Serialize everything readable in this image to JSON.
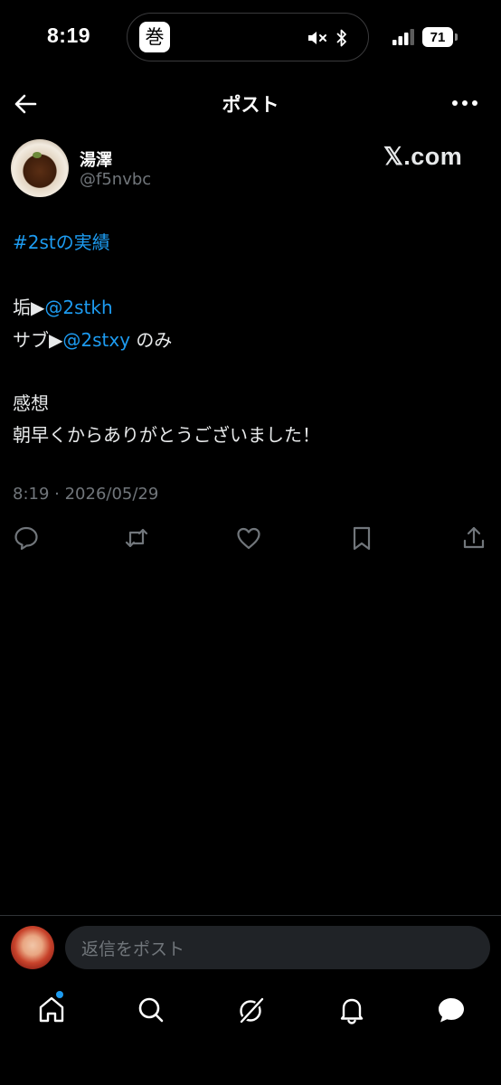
{
  "status_bar": {
    "time": "8:19",
    "battery": "71",
    "island_app_glyph": "巻"
  },
  "header": {
    "title": "ポスト"
  },
  "author": {
    "name": "湯澤",
    "handle": "@f5nvbc"
  },
  "watermark": "𝕏.com",
  "post": {
    "hashtag": "#2stの実績",
    "line2_prefix": "垢▶",
    "line2_mention": "@2stkh",
    "line3_prefix": "サブ▶",
    "line3_mention": "@2stxy",
    "line3_suffix": " のみ",
    "line4": "感想",
    "line5": "朝早くからありがとうございました！",
    "timestamp": "8:19 · 2026/05/29"
  },
  "reply": {
    "placeholder": "返信をポスト"
  },
  "colors": {
    "background": "#000000",
    "link": "#1d9bf0",
    "secondary_text": "#71767b",
    "input_background": "#202327"
  },
  "icons": {
    "back": "arrow-left-icon",
    "more": "more-horizontal-icon",
    "reply": "comment-icon",
    "repost": "repost-icon",
    "like": "heart-icon",
    "bookmark": "bookmark-icon",
    "share": "share-icon",
    "nav": [
      "home-icon",
      "search-icon",
      "grok-icon",
      "notifications-icon",
      "messages-icon"
    ]
  }
}
